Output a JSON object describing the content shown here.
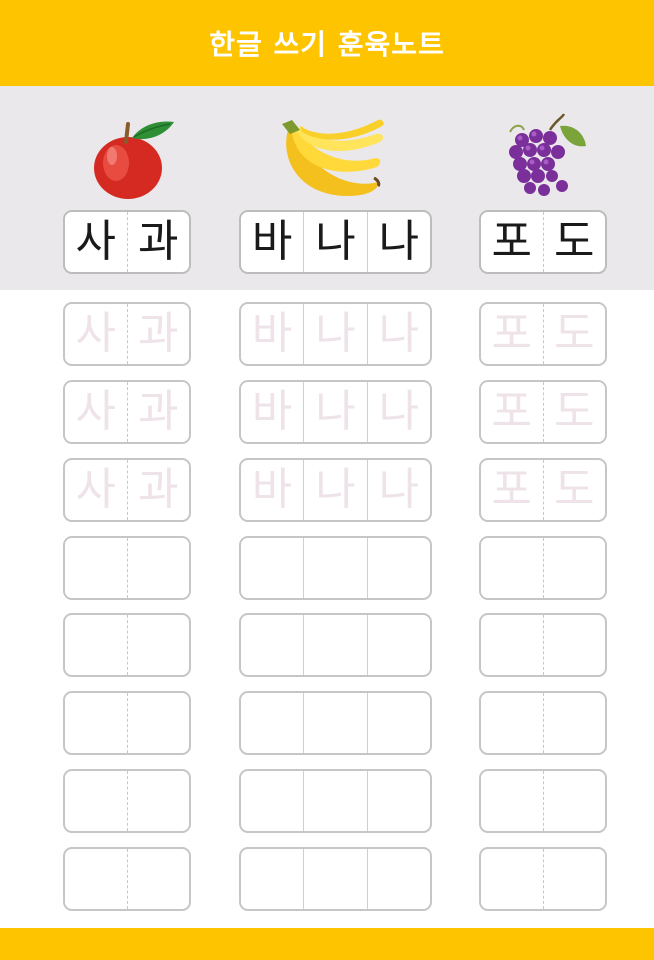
{
  "header": {
    "title": "한글 쓰기 훈육노트",
    "color": "#ffc400"
  },
  "columns": [
    {
      "name": "apple",
      "icon": "apple-icon",
      "chars": [
        "사",
        "과"
      ],
      "divider": "dashed"
    },
    {
      "name": "banana",
      "icon": "banana-icon",
      "chars": [
        "바",
        "나",
        "나"
      ],
      "divider": "solid"
    },
    {
      "name": "grape",
      "icon": "grape-icon",
      "chars": [
        "포",
        "도"
      ],
      "divider": "dashed"
    }
  ],
  "practice": {
    "trace_rows": 3,
    "blank_rows": 5
  },
  "colors": {
    "accent": "#ffc400",
    "band": "#ebe8ec",
    "trace": "#efe3ea"
  }
}
